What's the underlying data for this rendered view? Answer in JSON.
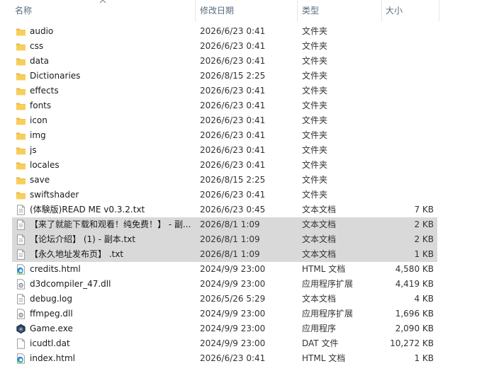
{
  "header": {
    "name": "名称",
    "date": "修改日期",
    "type": "类型",
    "size": "大小"
  },
  "files": [
    {
      "name": "audio",
      "date": "2026/6/23 0:41",
      "type": "文件夹",
      "size": "",
      "icon": "folder-icon"
    },
    {
      "name": "css",
      "date": "2026/6/23 0:41",
      "type": "文件夹",
      "size": "",
      "icon": "folder-icon"
    },
    {
      "name": "data",
      "date": "2026/6/23 0:41",
      "type": "文件夹",
      "size": "",
      "icon": "folder-icon"
    },
    {
      "name": "Dictionaries",
      "date": "2026/8/15 2:25",
      "type": "文件夹",
      "size": "",
      "icon": "folder-icon"
    },
    {
      "name": "effects",
      "date": "2026/6/23 0:41",
      "type": "文件夹",
      "size": "",
      "icon": "folder-icon"
    },
    {
      "name": "fonts",
      "date": "2026/6/23 0:41",
      "type": "文件夹",
      "size": "",
      "icon": "folder-icon"
    },
    {
      "name": "icon",
      "date": "2026/6/23 0:41",
      "type": "文件夹",
      "size": "",
      "icon": "folder-icon"
    },
    {
      "name": "img",
      "date": "2026/6/23 0:41",
      "type": "文件夹",
      "size": "",
      "icon": "folder-icon"
    },
    {
      "name": "js",
      "date": "2026/6/23 0:41",
      "type": "文件夹",
      "size": "",
      "icon": "folder-icon"
    },
    {
      "name": "locales",
      "date": "2026/6/23 0:41",
      "type": "文件夹",
      "size": "",
      "icon": "folder-icon"
    },
    {
      "name": "save",
      "date": "2026/8/15 2:25",
      "type": "文件夹",
      "size": "",
      "icon": "folder-icon"
    },
    {
      "name": "swiftshader",
      "date": "2026/6/23 0:41",
      "type": "文件夹",
      "size": "",
      "icon": "folder-icon"
    },
    {
      "name": "(体験版)READ ME v0.3.2.txt",
      "date": "2026/6/23 0:45",
      "type": "文本文档",
      "size": "7 KB",
      "icon": "text-file-icon"
    },
    {
      "name": "【来了就能下载和观看！纯免费！】 - 副...",
      "date": "2026/8/1 1:09",
      "type": "文本文档",
      "size": "2 KB",
      "icon": "text-file-icon",
      "selected": true
    },
    {
      "name": "【论坛介绍】 (1) - 副本.txt",
      "date": "2026/8/1 1:09",
      "type": "文本文档",
      "size": "2 KB",
      "icon": "text-file-icon",
      "selected": true
    },
    {
      "name": "【永久地址发布页】 .txt",
      "date": "2026/8/1 1:09",
      "type": "文本文档",
      "size": "1 KB",
      "icon": "text-file-icon",
      "selected": true
    },
    {
      "name": "credits.html",
      "date": "2024/9/9 23:00",
      "type": "HTML 文档",
      "size": "4,580 KB",
      "icon": "edge-html-icon"
    },
    {
      "name": "d3dcompiler_47.dll",
      "date": "2024/9/9 23:00",
      "type": "应用程序扩展",
      "size": "4,419 KB",
      "icon": "dll-file-icon"
    },
    {
      "name": "debug.log",
      "date": "2026/5/26 5:29",
      "type": "文本文档",
      "size": "4 KB",
      "icon": "text-file-icon"
    },
    {
      "name": "ffmpeg.dll",
      "date": "2024/9/9 23:00",
      "type": "应用程序扩展",
      "size": "1,696 KB",
      "icon": "dll-file-icon"
    },
    {
      "name": "Game.exe",
      "date": "2024/9/9 23:00",
      "type": "应用程序",
      "size": "2,090 KB",
      "icon": "app-exe-icon"
    },
    {
      "name": "icudtl.dat",
      "date": "2024/9/9 23:00",
      "type": "DAT 文件",
      "size": "10,272 KB",
      "icon": "blank-file-icon"
    },
    {
      "name": "index.html",
      "date": "2026/6/23 0:41",
      "type": "HTML 文档",
      "size": "1 KB",
      "icon": "edge-html-icon"
    }
  ]
}
